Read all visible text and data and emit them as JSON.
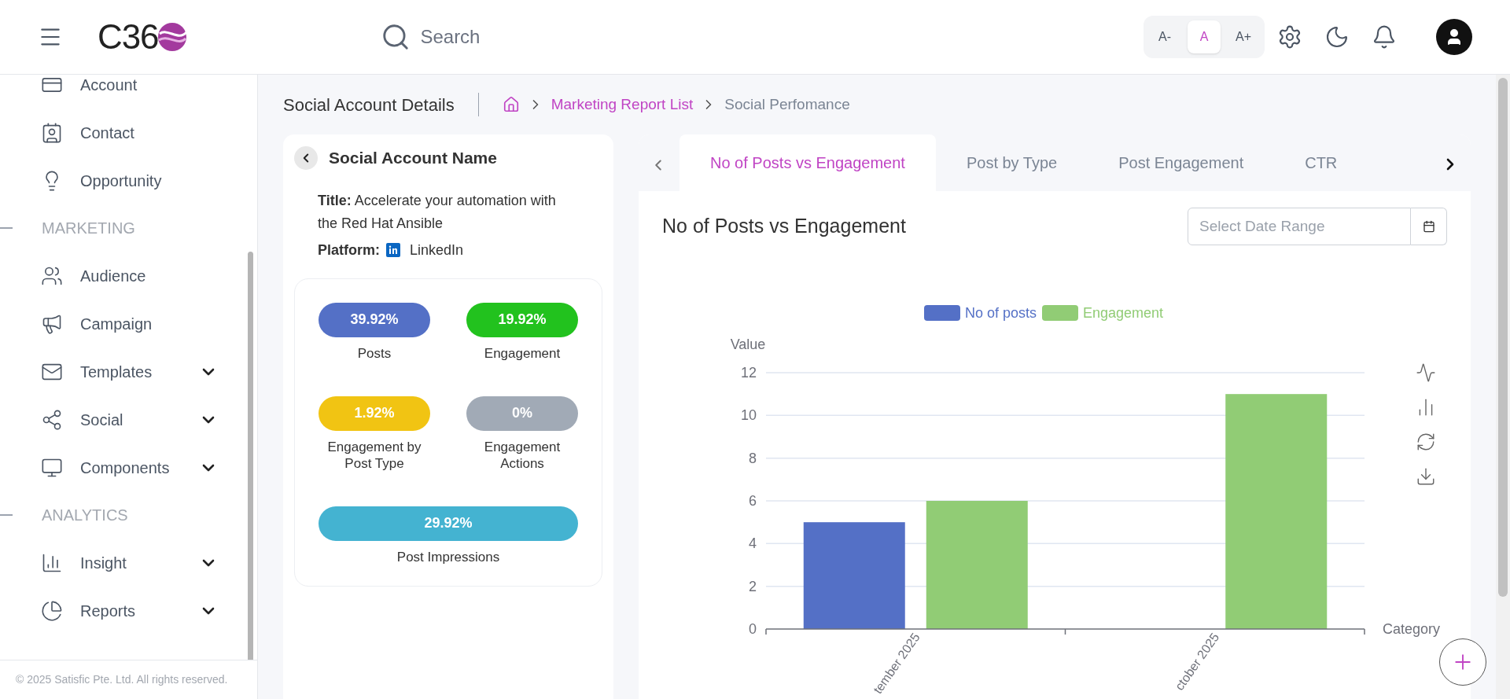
{
  "header": {
    "logo": "C36",
    "search": {
      "placeholder": "Search"
    },
    "font_sizes": [
      {
        "label": "A-",
        "selected": false
      },
      {
        "label": "A",
        "selected": true
      },
      {
        "label": "A+",
        "selected": false
      }
    ]
  },
  "sidebar": {
    "items": [
      {
        "kind": "link",
        "label": "Account"
      },
      {
        "kind": "link",
        "label": "Contact"
      },
      {
        "kind": "link",
        "label": "Opportunity"
      },
      {
        "kind": "heading",
        "label": "MARKETING"
      },
      {
        "kind": "link",
        "label": "Audience"
      },
      {
        "kind": "link",
        "label": "Campaign"
      },
      {
        "kind": "group",
        "label": "Templates"
      },
      {
        "kind": "group",
        "label": "Social"
      },
      {
        "kind": "group",
        "label": "Components"
      },
      {
        "kind": "heading",
        "label": "ANALYTICS"
      },
      {
        "kind": "group",
        "label": "Insight"
      },
      {
        "kind": "group",
        "label": "Reports"
      }
    ],
    "footer": "© 2025 Satisfic Pte. Ltd. All rights reserved."
  },
  "page": {
    "title": "Social Account Details",
    "breadcrumb": [
      {
        "kind": "link",
        "label": "Marketing Report List"
      },
      {
        "kind": "current",
        "label": "Social Perfomance"
      }
    ]
  },
  "account": {
    "name": "Social Account Name",
    "title": "**Title:** Accelerate your automation with the Red Hat Ansible",
    "platform_label": "Platform:",
    "platform": "LinkedIn",
    "stats": [
      {
        "value": "39.92%",
        "label": "Posts",
        "color": "#5470c6"
      },
      {
        "value": "19.92%",
        "label": "Engagement",
        "color": "#22c21e"
      },
      {
        "value": "1.92%",
        "label": "Engagement by Post Type",
        "color": "#f1c413"
      },
      {
        "value": "0%",
        "label": "Engagement Actions",
        "color": "#a1aab6"
      },
      {
        "value": "29.92%",
        "label": "Post Impressions",
        "color": "#44b3d1"
      }
    ]
  },
  "report": {
    "tabs": [
      {
        "label": "No of Posts vs Engagement",
        "selected": true
      },
      {
        "label": "Post by Type",
        "selected": false
      },
      {
        "label": "Post Engagement",
        "selected": false
      },
      {
        "label": "CTR",
        "selected": false
      }
    ],
    "heading": "No of Posts vs Engagement",
    "date_range": {
      "placeholder": "Select Date Range"
    },
    "chart_data": {
      "type": "bar",
      "ylabel": "Value",
      "xlabel": "Category",
      "categories": [
        "tember 2025",
        "ctober 2025"
      ],
      "series": [
        {
          "name": "No of posts",
          "color": "#5470c6",
          "values": [
            5,
            null
          ]
        },
        {
          "name": "Engagement",
          "color": "#91cc75",
          "values": [
            6,
            11
          ]
        }
      ],
      "ylim": [
        0,
        12
      ],
      "yticks": [
        0,
        2,
        4,
        6,
        8,
        10,
        12
      ],
      "legend": true,
      "grid": true
    }
  }
}
